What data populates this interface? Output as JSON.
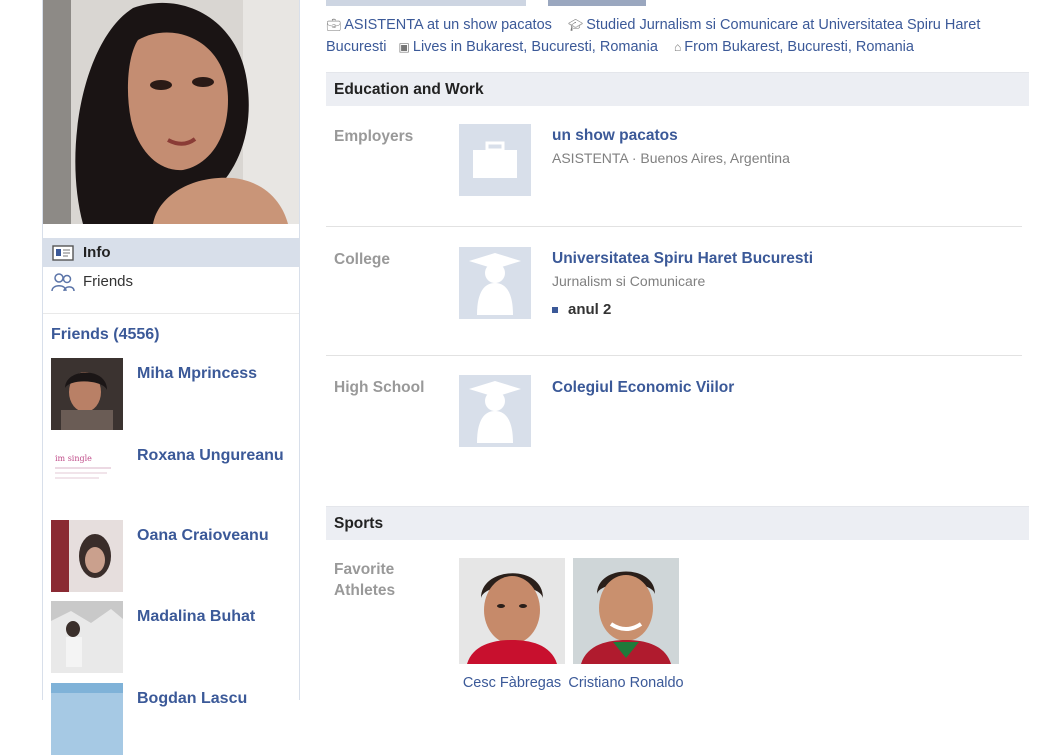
{
  "intro": {
    "work": "ASISTENTA at un show pacatos",
    "study": "Studied Jurnalism si Comunicare at Universitatea Spiru Haret Bucuresti",
    "lives": "Lives in Bukarest, Bucuresti, Romania",
    "from": "From Bukarest, Bucuresti, Romania",
    "icons": [
      "briefcase-icon",
      "graduation-cap-icon",
      "city-icon",
      "house-icon"
    ]
  },
  "nav": {
    "info_label": "Info",
    "friends_label": "Friends"
  },
  "friends": {
    "title": "Friends (4556)",
    "items": [
      {
        "name": "Miha Mprincess"
      },
      {
        "name": "Roxana Ungureanu"
      },
      {
        "name": "Oana Craioveanu"
      },
      {
        "name": "Madalina Buhat"
      },
      {
        "name": "Bogdan Lascu"
      }
    ],
    "thumb_caption": "im single"
  },
  "education_work": {
    "title": "Education and Work",
    "employers": {
      "label": "Employers",
      "name": "un show pacatos",
      "detail": "ASISTENTA · Buenos Aires, Argentina"
    },
    "college": {
      "label": "College",
      "name": "Universitatea Spiru Haret Bucuresti",
      "detail": "Jurnalism si Comunicare",
      "year": "anul 2"
    },
    "high_school": {
      "label": "High School",
      "name": "Colegiul Economic Viilor"
    }
  },
  "sports": {
    "title": "Sports",
    "label": "Favorite Athletes",
    "athletes": [
      {
        "name": "Cesc Fàbregas"
      },
      {
        "name": "Cristiano Ronaldo"
      }
    ]
  },
  "colors": {
    "link": "#3b5998",
    "section_bg": "#eceef3",
    "nav_active_bg": "#d8dfea",
    "placeholder_bg": "#d8dfea",
    "label_gray": "#999999"
  }
}
